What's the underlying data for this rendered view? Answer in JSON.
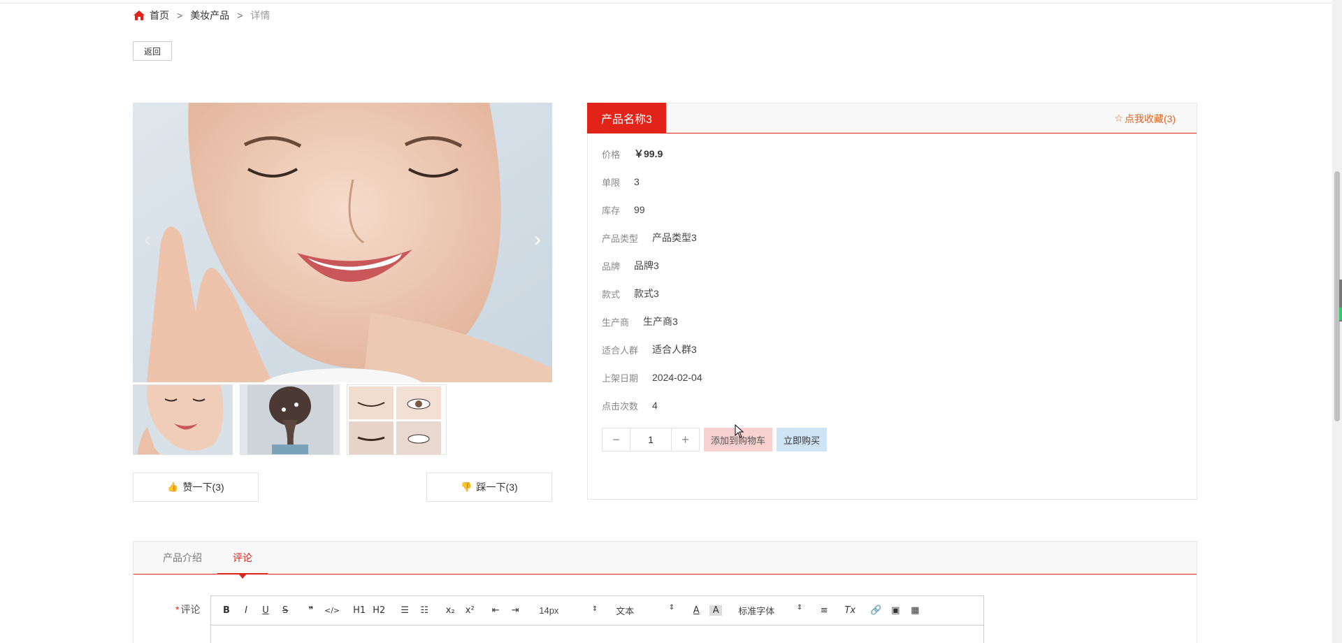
{
  "breadcrumb": {
    "home": "首页",
    "category": "美妆产品",
    "current": "详情",
    "separator": ">"
  },
  "back_button": "返回",
  "gallery": {
    "prev_arrow": "‹",
    "next_arrow": "›",
    "thumbnails": [
      "face-thumbnail",
      "hair-braid-thumbnail",
      "eyes-collage-thumbnail"
    ]
  },
  "votes": {
    "like_label": "赞一下(3)",
    "dislike_label": "踩一下(3)"
  },
  "product": {
    "name": "产品名称3",
    "favorite_label": "点我收藏(3)",
    "attributes": [
      {
        "label": "价格",
        "value": "￥99.9"
      },
      {
        "label": "单限",
        "value": "3"
      },
      {
        "label": "库存",
        "value": "99"
      },
      {
        "label": "产品类型",
        "value": "产品类型3"
      },
      {
        "label": "品牌",
        "value": "品牌3"
      },
      {
        "label": "款式",
        "value": "款式3"
      },
      {
        "label": "生产商",
        "value": "生产商3"
      },
      {
        "label": "适合人群",
        "value": "适合人群3"
      },
      {
        "label": "上架日期",
        "value": "2024-02-04"
      },
      {
        "label": "点击次数",
        "value": "4"
      }
    ],
    "quantity": "1",
    "qty_minus": "−",
    "qty_plus": "+",
    "add_to_cart": "添加到购物车",
    "buy_now": "立即购买"
  },
  "tabs": {
    "items": [
      {
        "label": "产品介绍",
        "active": false
      },
      {
        "label": "评论",
        "active": true
      }
    ]
  },
  "comment": {
    "required_mark": "*",
    "label": "评论",
    "toolbar": {
      "bold": "B",
      "italic": "I",
      "underline": "U",
      "strike": "S",
      "quote": "❞",
      "code": "</>",
      "h1": "H1",
      "h2": "H2",
      "ordered_list": "☰",
      "bullet_list": "☷",
      "subscript": "x₂",
      "superscript": "x²",
      "outdent": "⇤",
      "indent": "⇥",
      "font_size": "14px",
      "text_type": "文本",
      "font_color": "A",
      "bg_color": "A",
      "font_family": "标准字体",
      "align": "≡",
      "clear_format": "Tx",
      "link": "🔗",
      "image": "▣",
      "video": "▦"
    }
  },
  "colors": {
    "accent": "#e2231a",
    "favorite": "#e0641f",
    "add_cart_bg": "#f9d0d0",
    "buy_now_bg": "#cfe4f7"
  }
}
